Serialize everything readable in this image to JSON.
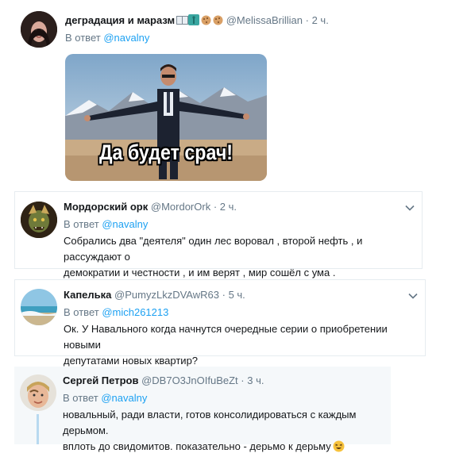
{
  "colors": {
    "link": "#1da1f2",
    "meta": "#657786",
    "text": "#14171a",
    "highlight_bg": "#f5f8fa",
    "border": "#e6ecf0"
  },
  "tweets": [
    {
      "name": "деградация и маразм",
      "emoji_icons": [
        "book-icon",
        "statue-of-liberty-icon",
        "cookie-icon",
        "cookie-icon"
      ],
      "handle": "@MelissaBrillian",
      "sep": "·",
      "time": "2 ч.",
      "reply_prefix": "В ответ",
      "reply_to": "@navalny",
      "image_caption": "Да будет срач!"
    },
    {
      "name": "Мордорский орк",
      "handle": "@MordorOrk",
      "sep": "·",
      "time": "2 ч.",
      "reply_prefix": "В ответ",
      "reply_to": "@navalny",
      "text_lines": [
        "Собрались два \"деятеля\" один лес воровал , второй нефть , и рассуждают о",
        "демократии и честности , и им верят , мир сошёл с ума ."
      ]
    },
    {
      "name": "Капелька",
      "handle": "@PumyzLkzDVAwR63",
      "sep": "·",
      "time": "5 ч.",
      "reply_prefix": "В ответ",
      "reply_to": "@mich261213",
      "text_lines": [
        "Ок. У Навального когда начнутся очередные серии о приобретении новыми",
        "депутатами новых квартир?"
      ]
    },
    {
      "name": "Сергей Петров",
      "handle": "@DB7O3JnOIfuBeZt",
      "sep": "·",
      "time": "3 ч.",
      "reply_prefix": "В ответ",
      "reply_to": "@navalny",
      "text_lines": [
        "новальный, ради власти, готов консолидироваться с каждым дерьмом.",
        "вплоть до свидомитов. показательно - дерьмо к дерьму"
      ],
      "trailing_emoji": "grinning-squinting-face-icon"
    }
  ]
}
